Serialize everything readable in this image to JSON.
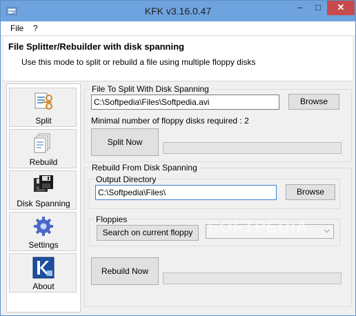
{
  "window": {
    "title": "KFK v3.16.0.47",
    "minimize": "–",
    "maximize": "□",
    "close": "✕"
  },
  "menu": [
    "File",
    "?"
  ],
  "header": {
    "title": "File Splitter/Rebuilder with disk spanning",
    "description": "Use this mode to split or rebuild a file using multiple floppy disks"
  },
  "sidebar": {
    "items": [
      {
        "label": "Split",
        "icon": "split-icon"
      },
      {
        "label": "Rebuild",
        "icon": "rebuild-icon"
      },
      {
        "label": "Disk Spanning",
        "icon": "floppy-disk-icon"
      },
      {
        "label": "Settings",
        "icon": "gear-icon"
      },
      {
        "label": "About",
        "icon": "kfk-logo-icon"
      }
    ]
  },
  "split": {
    "group_label": "File To Split With Disk Spanning",
    "file_path": "C:\\Softpedia\\Files\\Softpedia.avi",
    "browse_label": "Browse",
    "min_disks_text": "Minimal number of floppy disks required : 2",
    "split_now_label": "Split Now",
    "progress": 0
  },
  "rebuild": {
    "group_label": "Rebuild From Disk Spanning",
    "output_dir_label": "Output Directory",
    "output_dir_value": "C:\\Softpedia\\Files\\",
    "browse_label": "Browse",
    "floppies_label": "Floppies",
    "search_label": "Search on current floppy",
    "floppy_select": "",
    "rebuild_now_label": "Rebuild Now",
    "progress": 0
  },
  "watermark": "SOFTPEDIA",
  "colors": {
    "titlebar": "#6fa3e0",
    "close": "#c74b4b",
    "progress_fill": "#06b025"
  }
}
